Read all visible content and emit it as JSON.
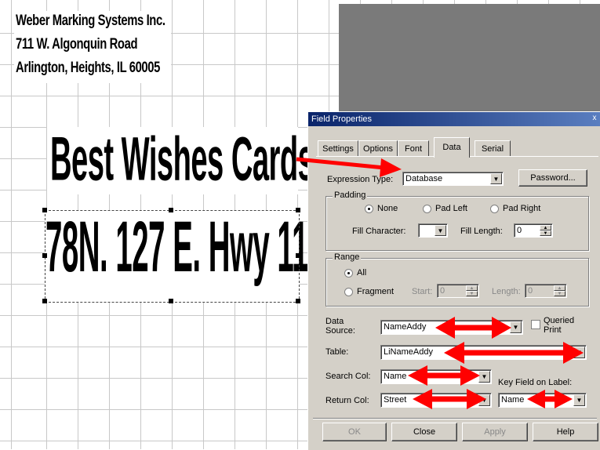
{
  "document": {
    "address_lines": [
      "Weber Marking Systems Inc.",
      "711 W. Algonquin Road",
      "Arlington, Heights, IL 60005"
    ],
    "big_text_1": "Best Wishes Cards",
    "big_text_2": "78N. 127 E. Hwy 11"
  },
  "dialog": {
    "title": "Field Properties",
    "close_glyph": "x",
    "tabs": [
      "Settings",
      "Options",
      "Font",
      "Data",
      "Serial"
    ],
    "active_tab": "Data",
    "expression_type": {
      "label": "Expression Type:",
      "value": "Database"
    },
    "password_label": "Password...",
    "padding": {
      "title": "Padding",
      "options": [
        "None",
        "Pad Left",
        "Pad Right"
      ],
      "selected": "None",
      "fill_character_label": "Fill Character:",
      "fill_character_value": "",
      "fill_length_label": "Fill Length:",
      "fill_length_value": "0"
    },
    "range": {
      "title": "Range",
      "options": [
        "All",
        "Fragment"
      ],
      "selected": "All",
      "start_label": "Start:",
      "start_value": "0",
      "length_label": "Length:",
      "length_value": "0"
    },
    "data_source": {
      "label_line1": "Data",
      "label_line2": "Source:",
      "value": "NameAddy"
    },
    "queried_print": {
      "line1": "Queried",
      "line2": "Print"
    },
    "table": {
      "label": "Table:",
      "value": "LiNameAddy"
    },
    "search_col": {
      "label": "Search Col:",
      "value": "Name"
    },
    "return_col": {
      "label": "Return Col:",
      "value": "Street"
    },
    "key_field": {
      "label": "Key Field on Label:",
      "value": "Name"
    },
    "buttons": [
      "OK",
      "Close",
      "Apply",
      "Help"
    ]
  },
  "colors": {
    "annotation_arrow": "#ff0000",
    "titlebar": "#0a246a",
    "dialog_bg": "#d4d0c8"
  }
}
